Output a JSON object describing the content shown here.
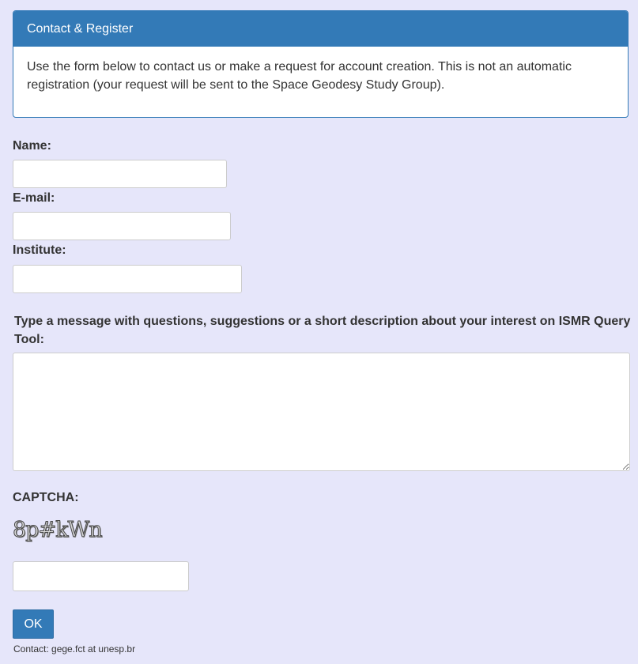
{
  "panel": {
    "title": "Contact & Register",
    "body": "Use the form below to contact us or make a request for account creation. This is not an automatic registration (your request will be sent to the Space Geodesy Study Group)."
  },
  "form": {
    "name_label": "Name:",
    "name_value": "",
    "email_label": "E-mail:",
    "email_value": "",
    "institute_label": "Institute:",
    "institute_value": "",
    "message_label": "Type a message with questions, suggestions or a short description about your interest on ISMR Query Tool:",
    "message_value": "",
    "captcha_label": "CAPTCHA:",
    "captcha_text": "8p#kWn",
    "captcha_value": "",
    "submit_label": "OK"
  },
  "footer": {
    "contact": "Contact: gege.fct at unesp.br"
  },
  "colors": {
    "background": "#e6e6fa",
    "primary": "#337ab7",
    "text": "#333333"
  }
}
